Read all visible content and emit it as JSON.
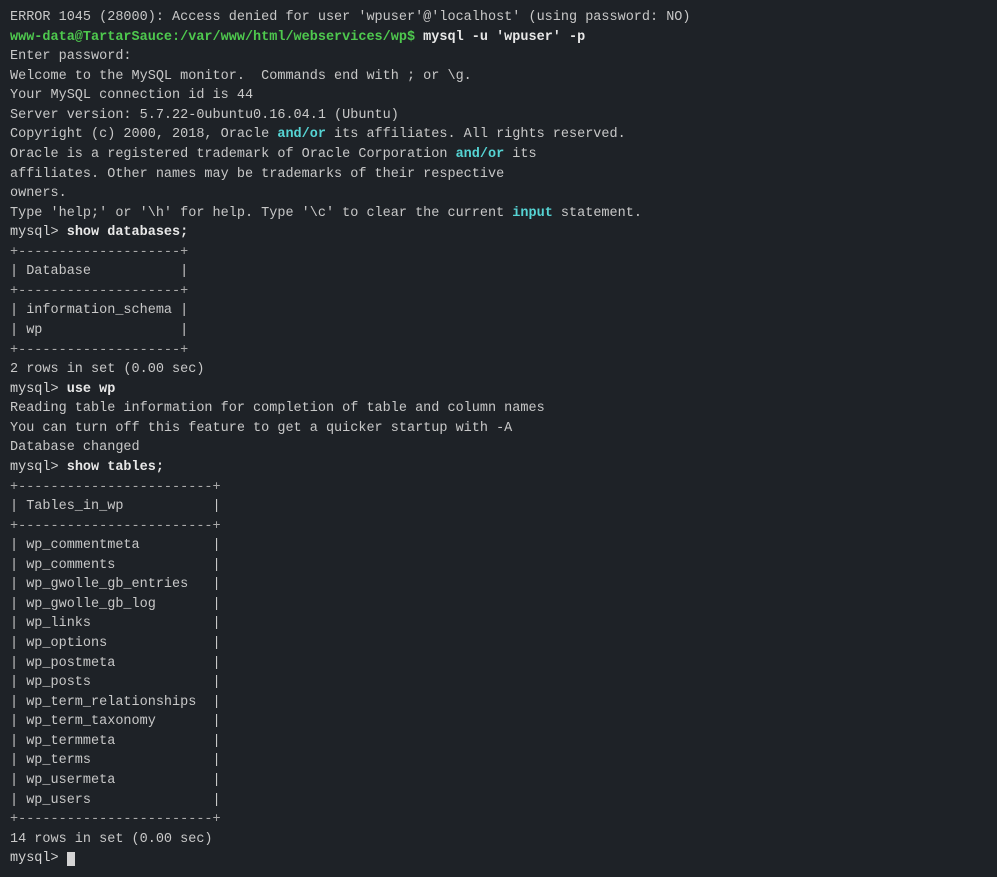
{
  "terminal": {
    "lines": [
      {
        "text": "ERROR 1045 (28000): Access denied for user 'wpuser'@'localhost' (using password: NO)",
        "color": "light"
      },
      {
        "text": "www-data@TartarSauce:/var/www/html/webservices/wp$ mysql -u 'wpuser' -p",
        "color": "green"
      },
      {
        "text": "Enter password:",
        "color": "light"
      },
      {
        "text": "Welcome to the MySQL monitor.  Commands end with ; or \\g.",
        "color": "light"
      },
      {
        "text": "Your MySQL connection id is 44",
        "color": "light"
      },
      {
        "text": "Server version: 5.7.22-0ubuntu0.16.04.1 (Ubuntu)",
        "color": "light"
      },
      {
        "text": "",
        "color": "light"
      },
      {
        "text": "Copyright (c) 2000, 2018, Oracle and/or its affiliates. All rights reserved.",
        "color": "light"
      },
      {
        "text": "",
        "color": "light"
      },
      {
        "text": "Oracle is a registered trademark of Oracle Corporation and/or its",
        "color": "light"
      },
      {
        "text": "affiliates. Other names may be trademarks of their respective",
        "color": "light"
      },
      {
        "text": "owners.",
        "color": "light"
      },
      {
        "text": "",
        "color": "light"
      },
      {
        "text": "Type 'help;' or '\\h' for help. Type '\\c' to clear the current input statement.",
        "color": "light"
      },
      {
        "text": "",
        "color": "light"
      },
      {
        "text": "mysql> show databases;",
        "color": "cmd"
      },
      {
        "text": "+--------------------+",
        "color": "table-border"
      },
      {
        "text": "| Database           |",
        "color": "light"
      },
      {
        "text": "+--------------------+",
        "color": "table-border"
      },
      {
        "text": "| information_schema |",
        "color": "light"
      },
      {
        "text": "| wp                 |",
        "color": "light"
      },
      {
        "text": "+--------------------+",
        "color": "table-border"
      },
      {
        "text": "2 rows in set (0.00 sec)",
        "color": "light"
      },
      {
        "text": "",
        "color": "light"
      },
      {
        "text": "mysql> use wp",
        "color": "cmd"
      },
      {
        "text": "Reading table information for completion of table and column names",
        "color": "light"
      },
      {
        "text": "You can turn off this feature to get a quicker startup with -A",
        "color": "light"
      },
      {
        "text": "",
        "color": "light"
      },
      {
        "text": "Database changed",
        "color": "light"
      },
      {
        "text": "mysql> show tables;",
        "color": "cmd"
      },
      {
        "text": "+------------------------+",
        "color": "table-border"
      },
      {
        "text": "| Tables_in_wp           |",
        "color": "light"
      },
      {
        "text": "+------------------------+",
        "color": "table-border"
      },
      {
        "text": "| wp_commentmeta         |",
        "color": "light"
      },
      {
        "text": "| wp_comments            |",
        "color": "light"
      },
      {
        "text": "| wp_gwolle_gb_entries   |",
        "color": "light"
      },
      {
        "text": "| wp_gwolle_gb_log       |",
        "color": "light"
      },
      {
        "text": "| wp_links               |",
        "color": "light"
      },
      {
        "text": "| wp_options             |",
        "color": "light"
      },
      {
        "text": "| wp_postmeta            |",
        "color": "light"
      },
      {
        "text": "| wp_posts               |",
        "color": "light"
      },
      {
        "text": "| wp_term_relationships  |",
        "color": "light"
      },
      {
        "text": "| wp_term_taxonomy       |",
        "color": "light"
      },
      {
        "text": "| wp_termmeta            |",
        "color": "light"
      },
      {
        "text": "| wp_terms               |",
        "color": "light"
      },
      {
        "text": "| wp_usermeta            |",
        "color": "light"
      },
      {
        "text": "| wp_users               |",
        "color": "light"
      },
      {
        "text": "+------------------------+",
        "color": "table-border"
      },
      {
        "text": "14 rows in set (0.00 sec)",
        "color": "light"
      },
      {
        "text": "",
        "color": "light"
      },
      {
        "text": "mysql> ",
        "color": "prompt",
        "cursor": true
      }
    ]
  }
}
